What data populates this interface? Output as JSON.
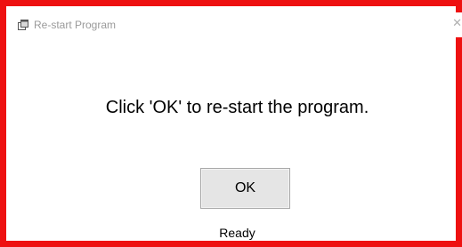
{
  "window": {
    "title": "Re-start Program",
    "close_glyph": "✕",
    "icon": "app-icon",
    "border_color": "#ee1111"
  },
  "dialog": {
    "message": "Click 'OK' to re-start the program.",
    "ok_label": "OK"
  },
  "status": {
    "text": "Ready"
  }
}
